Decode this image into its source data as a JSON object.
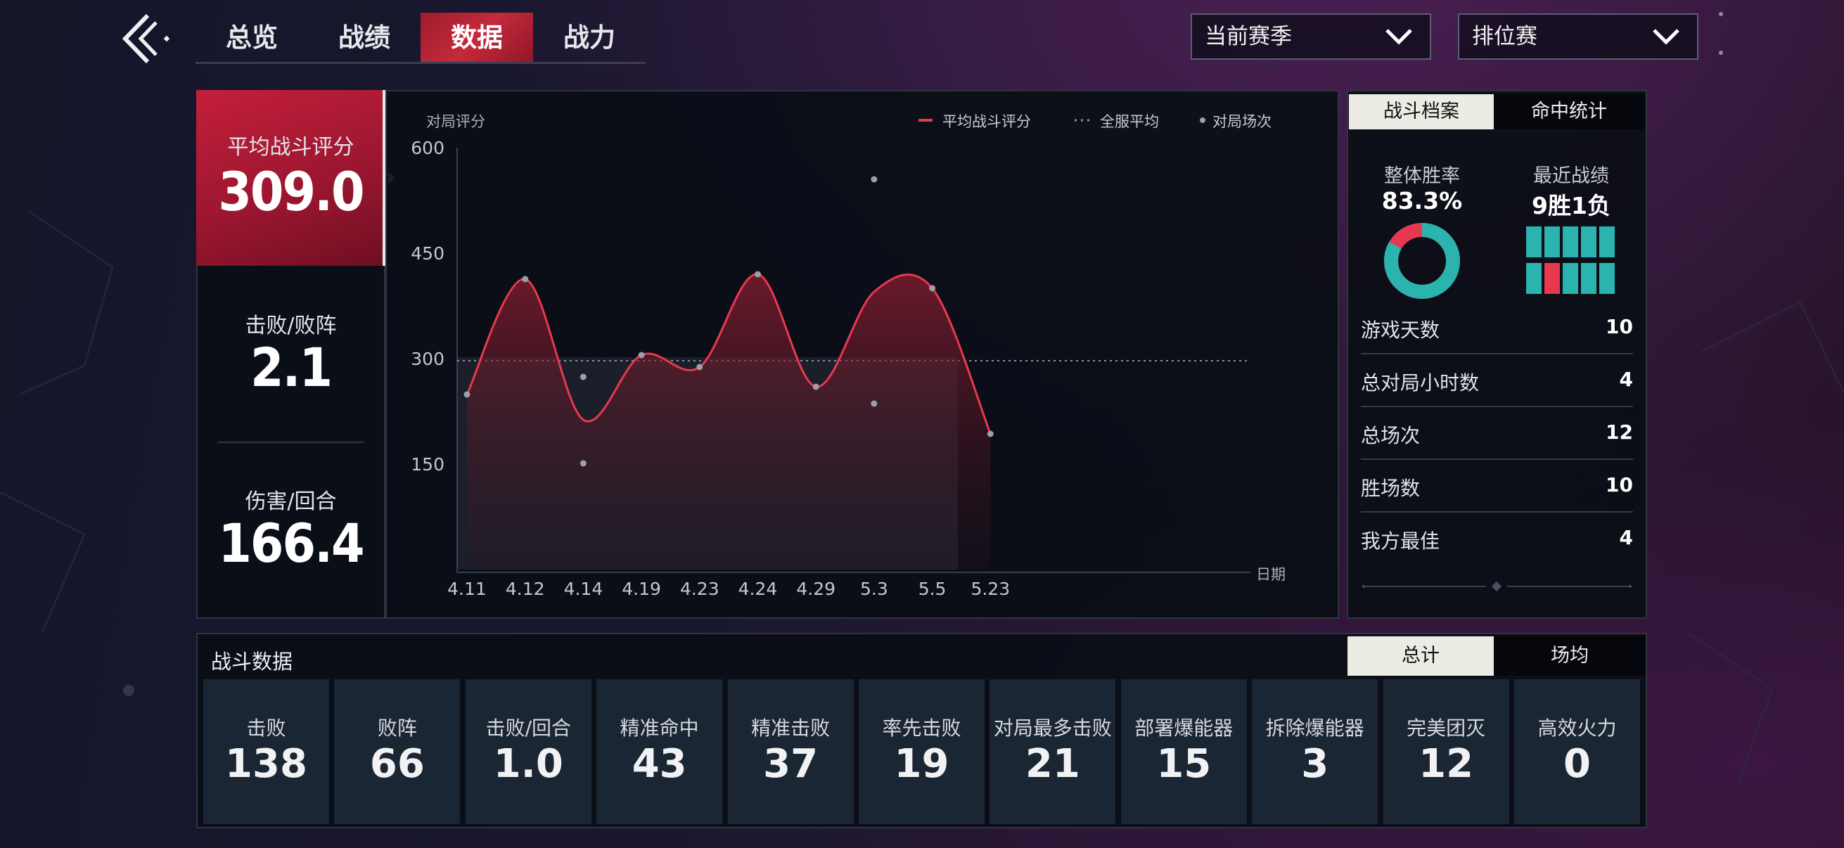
{
  "nav": {
    "tabs": [
      {
        "label": "总览"
      },
      {
        "label": "战绩"
      },
      {
        "label": "数据",
        "active": true
      },
      {
        "label": "战力"
      }
    ],
    "season_dropdown": "当前赛季",
    "mode_dropdown": "排位赛"
  },
  "summary": {
    "avg_rating_label": "平均战斗评分",
    "avg_rating_value": "309.0",
    "kd_label": "击败/败阵",
    "kd_value": "2.1",
    "dmg_label": "伤害/回合",
    "dmg_value": "166.4"
  },
  "chart_data": {
    "type": "line",
    "ylabel": "对局评分",
    "xlabel": "日期",
    "legend": {
      "position": "top-right",
      "items": [
        "平均战斗评分",
        "全服平均",
        "对局场次"
      ]
    },
    "ylim": [
      0,
      600
    ],
    "y_ticks": [
      600,
      450,
      300,
      150
    ],
    "categories": [
      "4.11",
      "4.12",
      "4.14",
      "4.19",
      "4.23",
      "4.24",
      "4.29",
      "5.3",
      "5.5",
      "5.23"
    ],
    "series": [
      {
        "name": "平均战斗评分",
        "values": [
          249,
          413,
          213,
          305,
          288,
          420,
          260,
          395,
          400,
          193
        ]
      }
    ],
    "server_average": 297,
    "match_points": [
      {
        "x": "4.12",
        "y": 413
      },
      {
        "x": "4.14",
        "y": 274
      },
      {
        "x": "4.14",
        "y": 151
      },
      {
        "x": "4.19",
        "y": 305
      },
      {
        "x": "4.23",
        "y": 288
      },
      {
        "x": "4.24",
        "y": 420
      },
      {
        "x": "4.29",
        "y": 260
      },
      {
        "x": "5.3",
        "y": 555
      },
      {
        "x": "5.3",
        "y": 236
      },
      {
        "x": "5.5",
        "y": 400
      },
      {
        "x": "5.23",
        "y": 193
      },
      {
        "x": "4.11",
        "y": 249
      }
    ],
    "colors": {
      "line": "#e8384f",
      "avg": "#8a93a3",
      "points": "#9aa0a8"
    }
  },
  "right": {
    "tabs": [
      "战斗档案",
      "命中统计"
    ],
    "win_rate_label": "整体胜率",
    "win_rate_value": "83.3%",
    "win_rate_fraction": 0.833,
    "recent_label": "最近战绩",
    "recent_value": "9胜1负",
    "recent_results": [
      "W",
      "W",
      "W",
      "W",
      "W",
      "W",
      "L",
      "W",
      "W",
      "W"
    ],
    "rows": [
      {
        "label": "游戏天数",
        "value": "10"
      },
      {
        "label": "总对局小时数",
        "value": "4"
      },
      {
        "label": "总场次",
        "value": "12"
      },
      {
        "label": "胜场数",
        "value": "10"
      },
      {
        "label": "我方最佳",
        "value": "4"
      }
    ],
    "colors": {
      "win": "#2bb3ad",
      "loss": "#e8384f"
    }
  },
  "combat": {
    "title": "战斗数据",
    "tabs": [
      "总计",
      "场均"
    ],
    "stats": [
      {
        "label": "击败",
        "value": "138"
      },
      {
        "label": "败阵",
        "value": "66"
      },
      {
        "label": "击败/回合",
        "value": "1.0"
      },
      {
        "label": "精准命中",
        "value": "43"
      },
      {
        "label": "精准击败",
        "value": "37"
      },
      {
        "label": "率先击败",
        "value": "19"
      },
      {
        "label": "对局最多击败",
        "value": "21"
      },
      {
        "label": "部署爆能器",
        "value": "15"
      },
      {
        "label": "拆除爆能器",
        "value": "3"
      },
      {
        "label": "完美团灭",
        "value": "12"
      },
      {
        "label": "高效火力",
        "value": "0"
      }
    ]
  }
}
